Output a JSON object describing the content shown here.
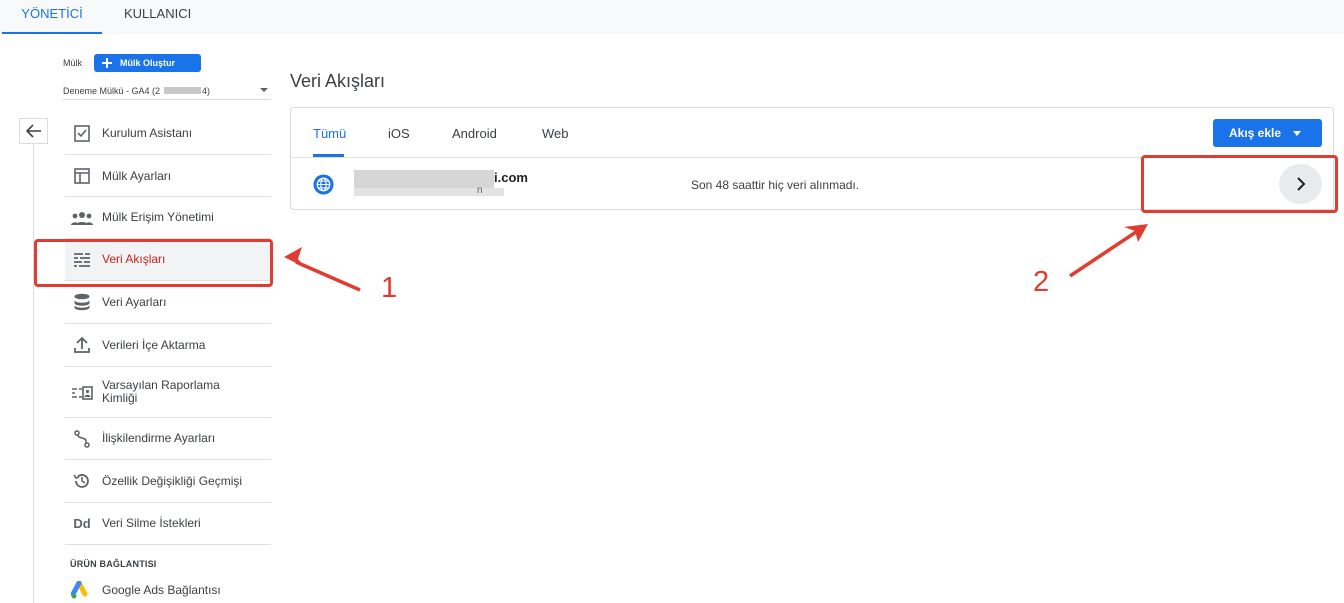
{
  "top_tabs": {
    "admin": "YÖNETİCİ",
    "user": "KULLANICI"
  },
  "property": {
    "label": "Mülk",
    "create_button": "Mülk Oluştur",
    "selected": "Deneme Mülkü - GA4 (2",
    "selected_end": "4)"
  },
  "sidebar": {
    "items": [
      {
        "label": "Kurulum Asistanı",
        "icon": "clipboard-check-icon"
      },
      {
        "label": "Mülk Ayarları",
        "icon": "window-layout-icon"
      },
      {
        "label": "Mülk Erişim Yönetimi",
        "icon": "people-icon"
      },
      {
        "label": "Veri Akışları",
        "icon": "data-streams-icon"
      },
      {
        "label": "Veri Ayarları",
        "icon": "database-icon"
      },
      {
        "label": "Verileri İçe Aktarma",
        "icon": "upload-icon"
      },
      {
        "label": "Varsayılan Raporlama Kimliği",
        "icon": "reporting-id-icon"
      },
      {
        "label": "İlişkilendirme Ayarları",
        "icon": "attribution-icon"
      },
      {
        "label": "Özellik Değişikliği Geçmişi",
        "icon": "history-icon"
      },
      {
        "label": "Veri Silme İstekleri",
        "icon": "dd-icon"
      }
    ],
    "section_label": "ÜRÜN BAĞLANTISI",
    "link_item": {
      "label": "Google Ads Bağlantısı",
      "icon": "google-ads-icon"
    }
  },
  "page_title": "Veri Akışları",
  "stream_tabs": [
    "Tümü",
    "iOS",
    "Android",
    "Web"
  ],
  "add_stream_button": "Akış ekle",
  "stream": {
    "domain_suffix": "i.com",
    "url_suffix": "n",
    "status": "Son 48 saattir hiç veri alınmadı."
  },
  "annotations": [
    "1",
    "2"
  ],
  "colors": {
    "accent": "#1a73e8",
    "annotation": "#e03c31",
    "active_text": "#c5221f"
  }
}
